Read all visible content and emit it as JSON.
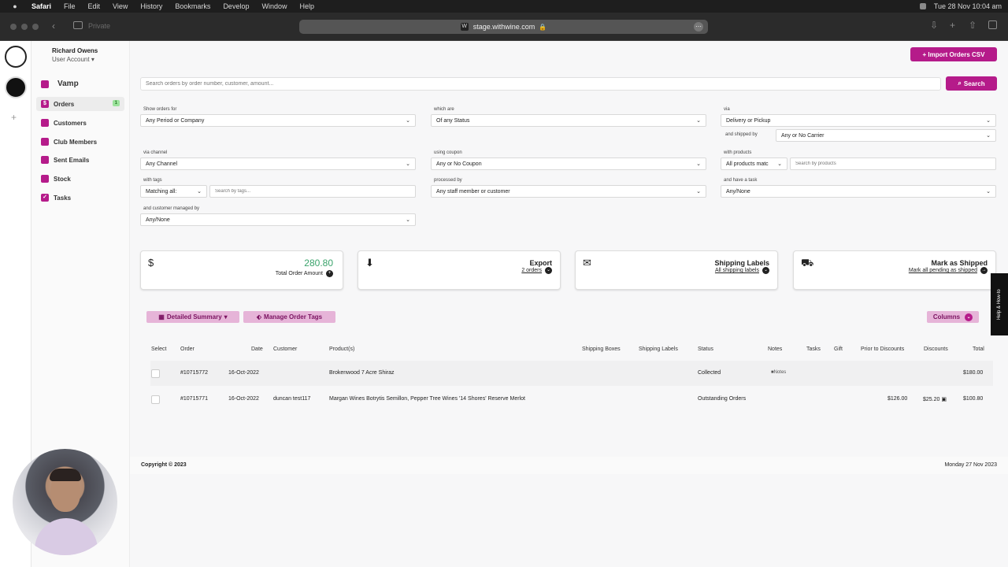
{
  "menubar": {
    "app": "Safari",
    "items": [
      "File",
      "Edit",
      "View",
      "History",
      "Bookmarks",
      "Develop",
      "Window",
      "Help"
    ],
    "datetime": "Tue 28 Nov  10:04 am"
  },
  "browser": {
    "private_label": "Private",
    "url": "stage.withwine.com"
  },
  "sidebar": {
    "user_name": "Richard Owens",
    "account_label": "User Account",
    "brand": "Vamp",
    "items": [
      {
        "label": "Orders",
        "badge": "1"
      },
      {
        "label": "Customers"
      },
      {
        "label": "Club Members"
      },
      {
        "label": "Sent Emails"
      },
      {
        "label": "Stock"
      },
      {
        "label": "Tasks"
      }
    ]
  },
  "header": {
    "import_button": "+ Import Orders CSV",
    "search_placeholder": "Search orders by order number, customer, amount...",
    "search_button": "Search"
  },
  "filters": {
    "show_orders_for": {
      "label": "Show orders for",
      "value": "Any Period or Company"
    },
    "which_are": {
      "label": "which are",
      "value": "Of any Status"
    },
    "via": {
      "label": "via",
      "value": "Delivery or Pickup"
    },
    "shipped_by": {
      "label": "and shipped by",
      "value": "Any or No Carrier"
    },
    "via_channel": {
      "label": "via channel",
      "value": "Any Channel"
    },
    "using_coupon": {
      "label": "using coupon",
      "value": "Any or No Coupon"
    },
    "with_products": {
      "label": "with products",
      "value": "All products matc",
      "search_placeholder": "Search by products"
    },
    "with_tags": {
      "label": "with tags",
      "value": "Matching all:",
      "search_placeholder": "Search by tags..."
    },
    "processed_by": {
      "label": "processed by",
      "value": "Any staff member or customer"
    },
    "have_task": {
      "label": "and have a task",
      "value": "Any/None"
    },
    "managed_by": {
      "label": "and customer managed by",
      "value": "Any/None"
    }
  },
  "cards": {
    "total": {
      "amount": "280.80",
      "label": "Total Order Amount"
    },
    "export": {
      "title": "Export",
      "sub": "2 orders"
    },
    "shipping": {
      "title": "Shipping Labels",
      "sub": "All shipping labels"
    },
    "shipped": {
      "title": "Mark as Shipped",
      "sub": "Mark all pending as shipped"
    }
  },
  "actions": {
    "summary": "Detailed Summary",
    "tags": "Manage Order Tags",
    "columns": "Columns"
  },
  "table": {
    "headers": [
      "Select",
      "Order",
      "Date",
      "Customer",
      "Product(s)",
      "Shipping Boxes",
      "Shipping Labels",
      "Status",
      "Notes",
      "Tasks",
      "Gift",
      "Prior to Discounts",
      "Discounts",
      "Total"
    ],
    "rows": [
      {
        "order": "#10715772",
        "date": "16-Oct-2022",
        "customer": "",
        "products": "Brokenwood 7 Acre Shiraz",
        "status": "Collected",
        "notes": "Notes",
        "prior": "",
        "discounts": "",
        "total": "$180.00"
      },
      {
        "order": "#10715771",
        "date": "16-Oct-2022",
        "customer": "duncan test117",
        "products": "Margan Wines Botrytis Semillon, Pepper Tree Wines '14 Shores' Reserve Merlot",
        "status": "Outstanding Orders",
        "notes": "",
        "prior": "$126.00",
        "discounts": "$25.20",
        "total": "$100.80"
      }
    ]
  },
  "footer": {
    "copyright": "Copyright © 2023",
    "date": "Monday 27 Nov 2023"
  },
  "help_tab": "Help & How-to",
  "colors": {
    "accent": "#b51b8a",
    "accent_light": "#e6b4d8",
    "amount_green": "#3aa36b"
  },
  "icons": [
    "apple-icon",
    "back-icon",
    "sidebar-icon",
    "lock-icon",
    "reload-icon",
    "download-icon",
    "new-tab-icon",
    "share-icon",
    "tabs-icon",
    "dollar-icon",
    "download-export-icon",
    "envelope-icon",
    "truck-icon",
    "chevron-down-icon",
    "search-icon",
    "tag-icon",
    "table-icon"
  ]
}
